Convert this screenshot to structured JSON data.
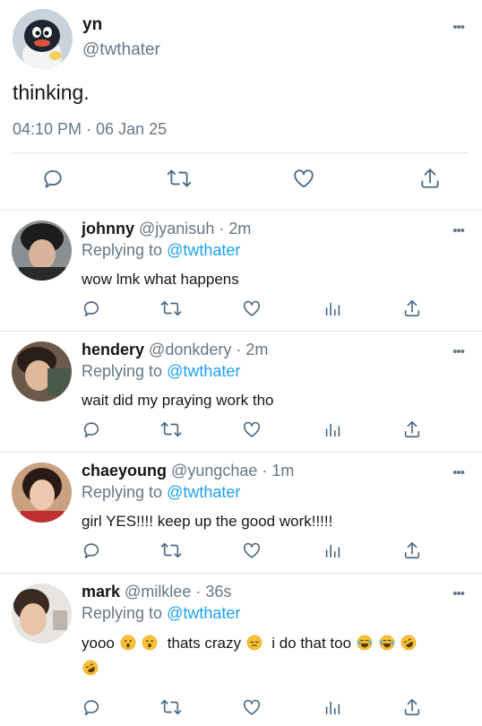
{
  "main": {
    "name": "yn",
    "handle": "@twthater",
    "text": "thinking.",
    "timestamp": "04:10 PM · 06 Jan 25",
    "avatar": "pingu-avatar"
  },
  "replies": [
    {
      "name": "johnny",
      "meta": "@jyanisuh · 2m",
      "replying_prefix": "Replying to",
      "mention": "@twthater",
      "text": "wow lmk what happens",
      "avatar_color": "#3a3a3a"
    },
    {
      "name": "hendery",
      "meta": "@donkdery · 2m",
      "replying_prefix": "Replying to",
      "mention": "@twthater",
      "text": "wait did my praying work tho",
      "avatar_color": "#5a4030"
    },
    {
      "name": "chaeyoung",
      "meta": "@yungchae · 1m",
      "replying_prefix": "Replying to",
      "mention": "@twthater",
      "text": "girl YES!!!! keep up the good work!!!!!",
      "avatar_color": "#b07060"
    },
    {
      "name": "mark",
      "meta": "@milklee · 36s",
      "replying_prefix": "Replying to",
      "mention": "@twthater",
      "text_part1": "yooo",
      "text_part2": "thats crazy",
      "text_part3": "i do that too",
      "emoji_names": [
        "hushed-face",
        "hushed-face",
        "pensive-face",
        "tears-of-joy",
        "tears-of-joy",
        "rofl"
      ],
      "avatar_color": "#d8c8c0"
    }
  ],
  "colors": {
    "accent": "#1da1f2",
    "secondary_text": "#657786",
    "icon": "#4a6a85",
    "divider": "#e1e8ed"
  },
  "icons": {
    "main_actions": [
      "reply-icon",
      "retweet-icon",
      "like-icon",
      "share-icon"
    ],
    "reply_actions": [
      "reply-icon",
      "retweet-icon",
      "like-icon",
      "analytics-icon",
      "share-icon"
    ]
  },
  "more_glyph": "•••"
}
